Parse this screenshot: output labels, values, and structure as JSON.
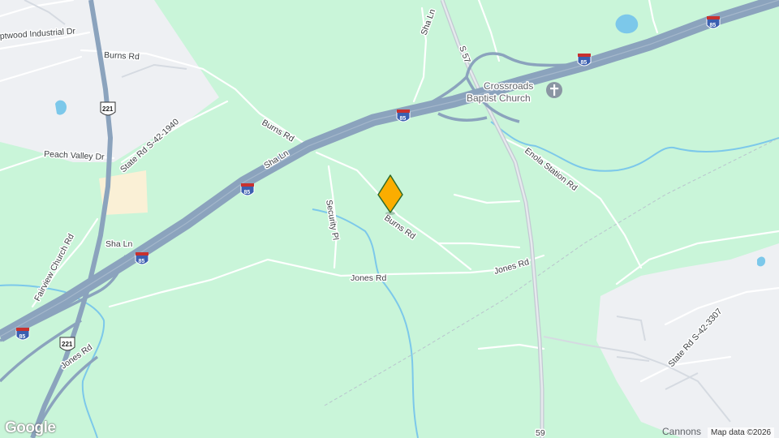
{
  "map": {
    "roads": {
      "sha_ln": "Sha Ln",
      "burns_rd": "Burns Rd",
      "jones_rd": "Jones Rd",
      "security_pl": "Security Pl",
      "enola_station_rd": "Enola Station Rd",
      "state_rd_1940": "State Rd S-42-1940",
      "state_rd_3307": "State Rd S-42-3307",
      "peach_valley_dr": "Peach Valley Dr",
      "fairview_church_rd": "Fairview Church Rd",
      "industrial_dr": "ptwood Industrial Dr",
      "s57": "S 57",
      "rd59": "59"
    },
    "shields": {
      "interstate": "85",
      "us_route": "221"
    },
    "poi": {
      "church_line1": "Crossroads",
      "church_line2": "Baptist Church"
    },
    "city": "Cannons",
    "attribution": "Map data ©2026",
    "logo": "Google",
    "marker_icon": "map-pin-icon",
    "colors": {
      "land": "#c9f5d9",
      "highway": "#8ba3bd",
      "water": "#7cc8ea",
      "urban": "#eef0f3",
      "marker": "#fbad00"
    }
  }
}
